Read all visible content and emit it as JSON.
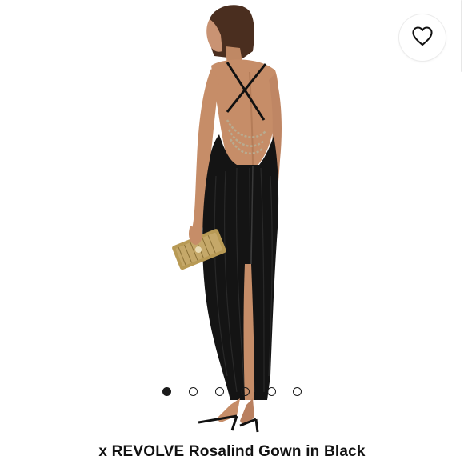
{
  "product": {
    "title": "x REVOLVE Rosalind Gown in Black",
    "image_description": "Model in black velvet backless gown with chain detail holding gold clutch"
  },
  "carousel": {
    "total_slides": 6,
    "active_index": 0
  },
  "colors": {
    "background": "#ffffff",
    "dot_active": "#1a1a1a",
    "gown": "#121212",
    "skin": "#c68d68",
    "gold": "#b89a55"
  },
  "icons": {
    "favorite": "heart-outline-icon"
  }
}
